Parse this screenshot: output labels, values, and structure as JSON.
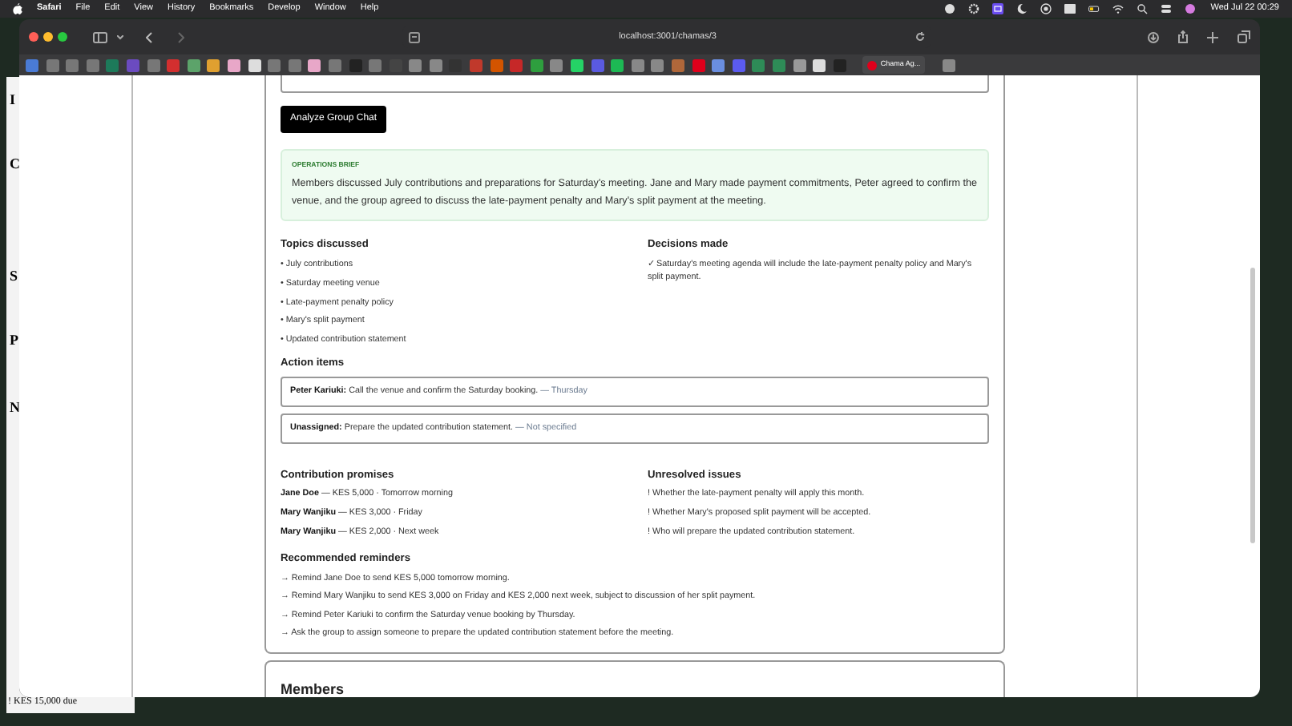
{
  "menu_bar": {
    "app": "Safari",
    "items": [
      "File",
      "Edit",
      "View",
      "History",
      "Bookmarks",
      "Develop",
      "Window",
      "Help"
    ],
    "clock": "Wed Jul 22  00:29"
  },
  "browser": {
    "url": "localhost:3001/chamas/3",
    "tab": {
      "title": "Chama Ag..."
    }
  },
  "background_window": {
    "letters": [
      "I",
      "C",
      "S",
      "P",
      "N"
    ],
    "line": "! KES 15,000 due"
  },
  "page": {
    "analyze_button": "Analyze Group Chat",
    "brief": {
      "label": "OPERATIONS BRIEF",
      "text": "Members discussed July contributions and preparations for Saturday's meeting. Jane and Mary made payment commitments, Peter agreed to confirm the venue, and the group agreed to discuss the late-payment penalty and Mary's split payment at the meeting."
    },
    "topics": {
      "title": "Topics discussed",
      "items": [
        "• July contributions",
        "• Saturday meeting venue",
        "• Late-payment penalty policy",
        "• Mary's split payment",
        "• Updated contribution statement"
      ]
    },
    "decisions": {
      "title": "Decisions made",
      "items": [
        "✓ Saturday's meeting agenda will include the late-payment penalty policy and Mary's split payment."
      ]
    },
    "action_items": {
      "title": "Action items",
      "items": [
        {
          "assignee": "Peter Kariuki:",
          "task": "Call the venue and confirm the Saturday booking.",
          "due": "— Thursday"
        },
        {
          "assignee": "Unassigned:",
          "task": "Prepare the updated contribution statement.",
          "due": "— Not specified"
        }
      ]
    },
    "contributions": {
      "title": "Contribution promises",
      "items": [
        {
          "name": "Jane Doe",
          "detail": "— KES 5,000 · Tomorrow morning"
        },
        {
          "name": "Mary Wanjiku",
          "detail": "— KES 3,000 · Friday"
        },
        {
          "name": "Mary Wanjiku",
          "detail": "— KES 2,000 · Next week"
        }
      ]
    },
    "unresolved": {
      "title": "Unresolved issues",
      "items": [
        "! Whether the late-payment penalty will apply this month.",
        "! Whether Mary's proposed split payment will be accepted.",
        "! Who will prepare the updated contribution statement."
      ]
    },
    "reminders": {
      "title": "Recommended reminders",
      "items": [
        "→ Remind Jane Doe to send KES 5,000 tomorrow morning.",
        "→ Remind Mary Wanjiku to send KES 3,000 on Friday and KES 2,000 next week, subject to discussion of her split payment.",
        "→ Remind Peter Kariuki to confirm the Saturday venue booking by Thursday.",
        "→ Ask the group to assign someone to prepare the updated contribution statement before the meeting."
      ]
    },
    "next_section": "Members"
  }
}
